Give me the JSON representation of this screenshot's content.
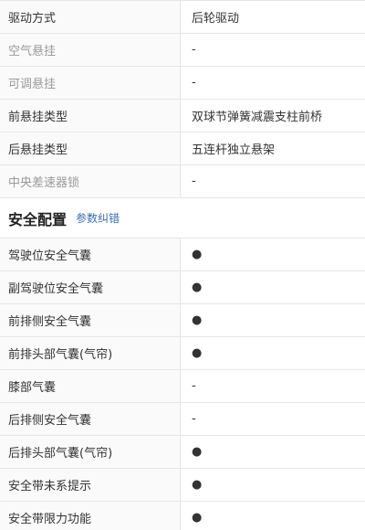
{
  "top_rows": [
    {
      "label": "驱动方式",
      "value": "后轮驱动",
      "dim": false
    },
    {
      "label": "空气悬挂",
      "value": "-",
      "dim": true
    },
    {
      "label": "可调悬挂",
      "value": "-",
      "dim": true
    },
    {
      "label": "前悬挂类型",
      "value": "双球节弹簧减震支柱前桥",
      "dim": false
    },
    {
      "label": "后悬挂类型",
      "value": "五连杆独立悬架",
      "dim": false
    },
    {
      "label": "中央差速器锁",
      "value": "-",
      "dim": true
    }
  ],
  "section": {
    "title": "安全配置",
    "link": "参数纠错"
  },
  "safety_rows": [
    {
      "label": "驾驶位安全气囊",
      "value": "●"
    },
    {
      "label": "副驾驶位安全气囊",
      "value": "●"
    },
    {
      "label": "前排侧安全气囊",
      "value": "●"
    },
    {
      "label": "前排头部气囊(气帘)",
      "value": "●"
    },
    {
      "label": "膝部气囊",
      "value": "-"
    },
    {
      "label": "后排侧安全气囊",
      "value": "-"
    },
    {
      "label": "后排头部气囊(气帘)",
      "value": "●"
    },
    {
      "label": "安全带未系提示",
      "value": "●"
    },
    {
      "label": "安全带限力功能",
      "value": "●"
    }
  ]
}
